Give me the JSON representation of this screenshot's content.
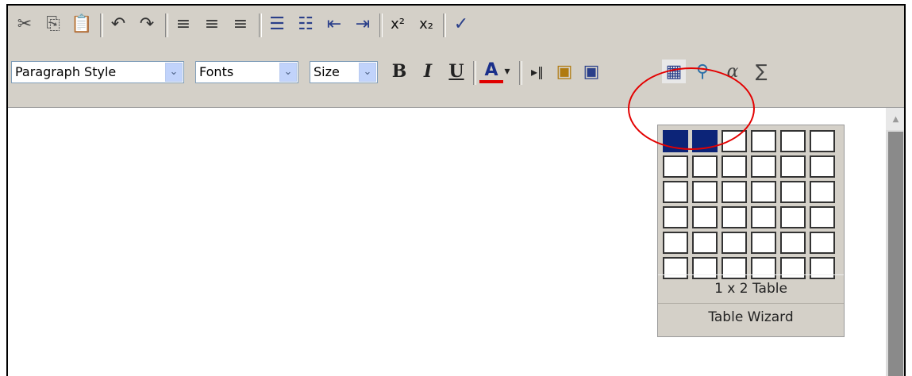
{
  "toolbar_row1": {
    "buttons": [
      {
        "name": "cut",
        "glyph": "✂",
        "color": "#444"
      },
      {
        "name": "copy",
        "glyph": "⎘",
        "color": "#555"
      },
      {
        "name": "paste",
        "glyph": "📋",
        "color": "#7a5a2a"
      },
      {
        "name": "undo",
        "glyph": "↶",
        "color": "#333"
      },
      {
        "name": "redo",
        "glyph": "↷",
        "color": "#333"
      },
      {
        "name": "align-left",
        "glyph": "≡",
        "color": "#333"
      },
      {
        "name": "align-center",
        "glyph": "≡",
        "color": "#333"
      },
      {
        "name": "align-right",
        "glyph": "≡",
        "color": "#333"
      },
      {
        "name": "numbered-list",
        "glyph": "☰",
        "color": "#2a3f8a"
      },
      {
        "name": "bulleted-list",
        "glyph": "☷",
        "color": "#2a3f8a"
      },
      {
        "name": "outdent",
        "glyph": "⇤",
        "color": "#2a3f8a"
      },
      {
        "name": "indent",
        "glyph": "⇥",
        "color": "#2a3f8a"
      },
      {
        "name": "superscript",
        "glyph": "x²",
        "color": "#111"
      },
      {
        "name": "subscript",
        "glyph": "x₂",
        "color": "#111"
      },
      {
        "name": "spellcheck",
        "glyph": "✓",
        "color": "#2a3f8a"
      }
    ]
  },
  "toolbar_row2": {
    "paragraph_style": "Paragraph Style",
    "fonts": "Fonts",
    "size": "Size",
    "bold": "B",
    "italic": "I",
    "underline": "U",
    "font_color": "A",
    "dropdown_arrow": "▾",
    "combo_arrow": "⌄",
    "insert_image_glyph": "▣",
    "table_glyph": "▦",
    "special_char": "α",
    "sigma": "∑"
  },
  "table_popup": {
    "rows": 6,
    "cols": 6,
    "selected_rows": 1,
    "selected_cols": 2,
    "size_label": "1 x 2 Table",
    "wizard_label": "Table Wizard"
  },
  "scrollbar": {
    "up_arrow": "▲"
  },
  "colors": {
    "toolbar_bg": "#d4d0c8",
    "selected_cell": "#0c2478",
    "highlight_circle": "#e30000",
    "font_color_underline": "#e00000"
  }
}
